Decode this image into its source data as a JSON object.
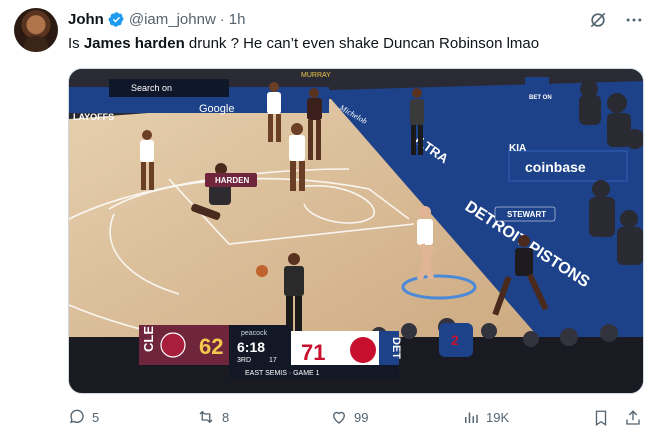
{
  "tweet": {
    "author_name": "John",
    "handle": "@iam_johnw",
    "separator": "·",
    "time": "1h",
    "text_pre": "Is ",
    "text_bold": "James harden",
    "text_post": " drunk ? He can’t even shake Duncan Robinson lmao"
  },
  "media": {
    "board_playoffs": "LAYOFFS",
    "board_google": "Google",
    "board_search": "Search on",
    "board_legacy": "MURRAY",
    "floor_ultra": "ULTRA",
    "floor_ultra_brand": "Michelob",
    "floor_detroit": "DETROIT PISTONS",
    "coinbase": "coinbase",
    "kia": "KIA",
    "bet": "BET ON",
    "player_tag_harden": "HARDEN",
    "player_tag_stewart": "STEWART",
    "scoreboard": {
      "away_team": "CLE",
      "away_score": "62",
      "home_team": "DET",
      "home_score": "71",
      "network": "peacock",
      "clock": "6:18",
      "quarter": "3RD",
      "shot_clock": "17",
      "series": "EAST SEMIS · GAME 1"
    },
    "jersey_number": "2"
  },
  "actions": {
    "replies": "5",
    "reposts": "8",
    "likes": "99",
    "views": "19K"
  },
  "colors": {
    "accent": "#1d9bf0",
    "muted": "#536471",
    "pistons_blue": "#1d428a",
    "pistons_red": "#c8102e",
    "cavs_wine": "#6f263d"
  }
}
